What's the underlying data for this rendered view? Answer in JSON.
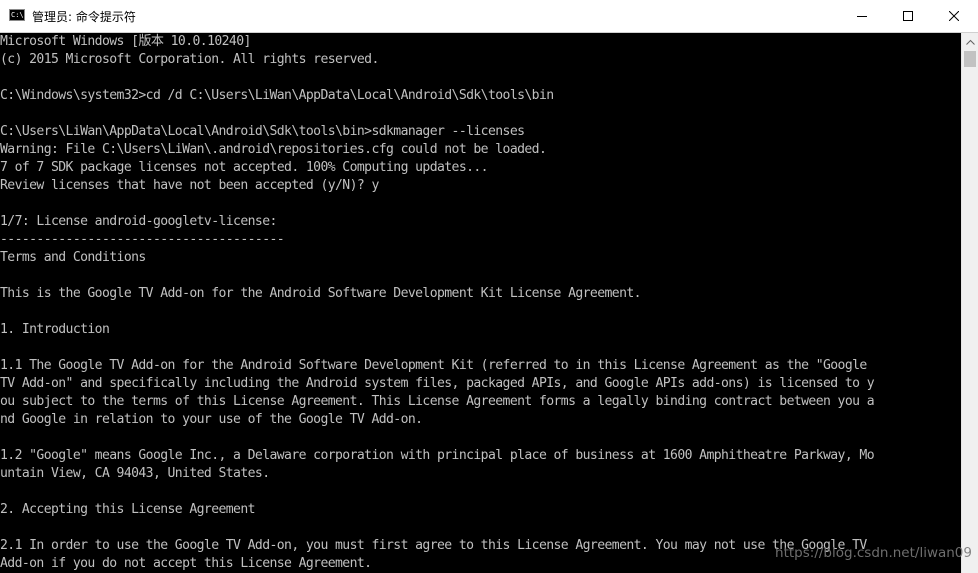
{
  "window": {
    "title": "管理员: 命令提示符",
    "icon_text": "C:\\.",
    "icon": "console-icon",
    "controls": [
      "minimize-icon",
      "maximize-icon",
      "close-icon"
    ]
  },
  "console": {
    "lines": [
      "Microsoft Windows [版本 10.0.10240]",
      "(c) 2015 Microsoft Corporation. All rights reserved.",
      "",
      "C:\\Windows\\system32>cd /d C:\\Users\\LiWan\\AppData\\Local\\Android\\Sdk\\tools\\bin",
      "",
      "C:\\Users\\LiWan\\AppData\\Local\\Android\\Sdk\\tools\\bin>sdkmanager --licenses",
      "Warning: File C:\\Users\\LiWan\\.android\\repositories.cfg could not be loaded.",
      "7 of 7 SDK package licenses not accepted. 100% Computing updates...",
      "Review licenses that have not been accepted (y/N)? y",
      "",
      "1/7: License android-googletv-license:",
      "---------------------------------------",
      "Terms and Conditions",
      "",
      "This is the Google TV Add-on for the Android Software Development Kit License Agreement.",
      "",
      "1. Introduction",
      "",
      "1.1 The Google TV Add-on for the Android Software Development Kit (referred to in this License Agreement as the \"Google",
      "TV Add-on\" and specifically including the Android system files, packaged APIs, and Google APIs add-ons) is licensed to y",
      "ou subject to the terms of this License Agreement. This License Agreement forms a legally binding contract between you a",
      "nd Google in relation to your use of the Google TV Add-on.",
      "",
      "1.2 \"Google\" means Google Inc., a Delaware corporation with principal place of business at 1600 Amphitheatre Parkway, Mo",
      "untain View, CA 94043, United States.",
      "",
      "2. Accepting this License Agreement",
      "",
      "2.1 In order to use the Google TV Add-on, you must first agree to this License Agreement. You may not use the Google TV",
      "Add-on if you do not accept this License Agreement."
    ]
  },
  "watermark": "https://blog.csdn.net/liwan09",
  "colors": {
    "console_bg": "#000000",
    "console_text": "#c0c0c0",
    "titlebar_bg": "#ffffff",
    "scrollbar_bg": "#f0f0f0",
    "scroll_thumb": "#c2c2c2"
  }
}
